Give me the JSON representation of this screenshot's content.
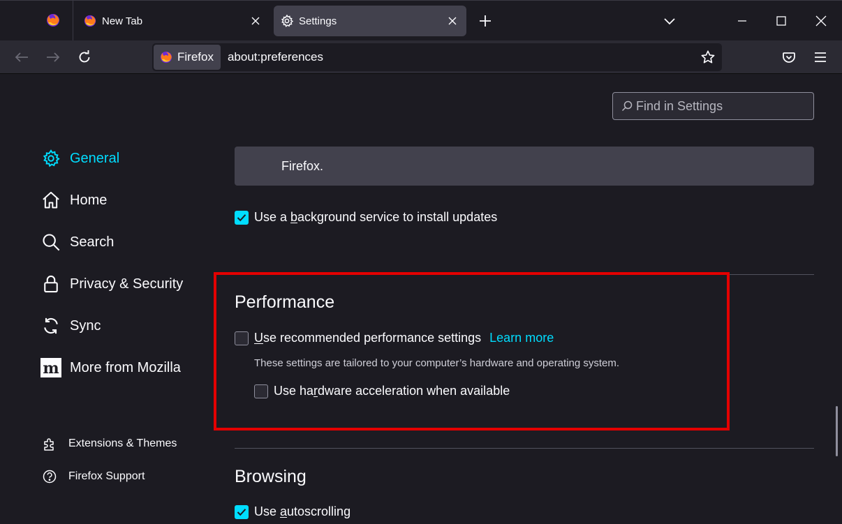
{
  "tabs": [
    {
      "title": "New Tab",
      "icon": "firefox-icon",
      "active": false
    },
    {
      "title": "Settings",
      "icon": "gear-icon",
      "active": true
    }
  ],
  "window_controls": [
    "list-all-tabs-chevron-icon",
    "minimize-icon",
    "maximize-icon",
    "close-icon"
  ],
  "urlbar": {
    "identity_label": "Firefox",
    "url": "about:preferences"
  },
  "search": {
    "placeholder": "Find in Settings"
  },
  "sidebar": {
    "items": [
      {
        "label": "General",
        "icon": "gear-icon",
        "selected": true
      },
      {
        "label": "Home",
        "icon": "home-icon"
      },
      {
        "label": "Search",
        "icon": "search-icon"
      },
      {
        "label": "Privacy & Security",
        "icon": "lock-icon"
      },
      {
        "label": "Sync",
        "icon": "sync-icon"
      },
      {
        "label": "More from Mozilla",
        "icon": "mozilla-m-icon"
      }
    ],
    "footer": [
      {
        "label": "Extensions & Themes",
        "icon": "puzzle-icon"
      },
      {
        "label": "Firefox Support",
        "icon": "help-icon"
      }
    ]
  },
  "updates": {
    "box_text": "Firefox.",
    "background_service": {
      "pre": "Use a ",
      "accesskey": "b",
      "post": "ackground service to install updates",
      "checked": true
    }
  },
  "performance": {
    "title": "Performance",
    "recommended": {
      "accesskey": "U",
      "post": "se recommended performance settings",
      "checked": false
    },
    "learn_more": "Learn more",
    "description": "These settings are tailored to your computer’s hardware and operating system.",
    "hw_accel": {
      "pre": "Use ha",
      "accesskey": "r",
      "post": "dware acceleration when available",
      "checked": false
    }
  },
  "browsing": {
    "title": "Browsing",
    "autoscroll": {
      "pre": "Use ",
      "accesskey": "a",
      "post": "utoscrolling",
      "checked": true
    }
  },
  "colors": {
    "accent": "#00ddff",
    "highlight": "#e30000",
    "panel": "#42414d",
    "background": "#1c1b22"
  }
}
